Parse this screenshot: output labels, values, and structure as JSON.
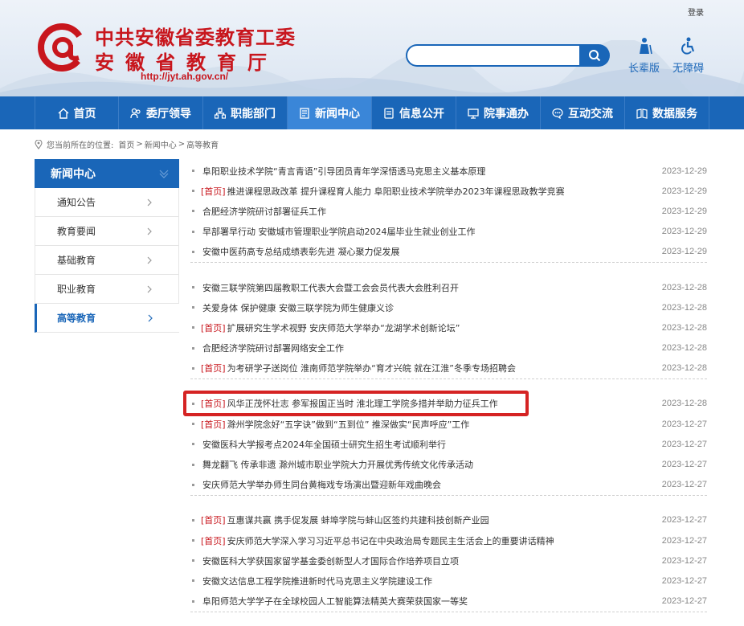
{
  "header": {
    "login": "登录",
    "title_line1": "中共安徽省委教育工委",
    "title_line2": "安徽省教育厅",
    "url": "http://jyt.ah.gov.cn/",
    "tools": [
      {
        "label": "长辈版",
        "icon": "elder-icon"
      },
      {
        "label": "无障碍",
        "icon": "accessibility-icon"
      }
    ],
    "search": {
      "placeholder": ""
    }
  },
  "nav": {
    "items": [
      {
        "label": "首页",
        "icon": "home-icon"
      },
      {
        "label": "委厅领导",
        "icon": "leaders-icon"
      },
      {
        "label": "职能部门",
        "icon": "departments-icon"
      },
      {
        "label": "新闻中心",
        "icon": "news-icon",
        "active": true
      },
      {
        "label": "信息公开",
        "icon": "info-icon"
      },
      {
        "label": "院事通办",
        "icon": "service-icon"
      },
      {
        "label": "互动交流",
        "icon": "chat-icon"
      },
      {
        "label": "数据服务",
        "icon": "data-icon"
      }
    ]
  },
  "breadcrumb": {
    "prefix": "您当前所在的位置:",
    "crumbs": [
      "首页",
      "新闻中心",
      "高等教育"
    ],
    "separator": ">"
  },
  "sidebar": {
    "heading": "新闻中心",
    "items": [
      {
        "label": "通知公告"
      },
      {
        "label": "教育要闻"
      },
      {
        "label": "基础教育"
      },
      {
        "label": "职业教育"
      },
      {
        "label": "高等教育",
        "active": true
      }
    ]
  },
  "list": {
    "groups": [
      [
        {
          "tag": "",
          "title": "阜阳职业技术学院“青言青语”引导团员青年学深悟透马克思主义基本原理",
          "date": "2023-12-29"
        },
        {
          "tag": "[首页]",
          "title": "推进课程思政改革 提升课程育人能力 阜阳职业技术学院举办2023年课程思政教学竞赛",
          "date": "2023-12-29"
        },
        {
          "tag": "",
          "title": "合肥经济学院研讨部署征兵工作",
          "date": "2023-12-29"
        },
        {
          "tag": "",
          "title": "早部署早行动 安徽城市管理职业学院启动2024届毕业生就业创业工作",
          "date": "2023-12-29"
        },
        {
          "tag": "",
          "title": "安徽中医药高专总结成绩表彰先进 凝心聚力促发展",
          "date": "2023-12-29"
        }
      ],
      [
        {
          "tag": "",
          "title": "安徽三联学院第四届教职工代表大会暨工会会员代表大会胜利召开",
          "date": "2023-12-28"
        },
        {
          "tag": "",
          "title": "关爱身体 保护健康 安徽三联学院为师生健康义诊",
          "date": "2023-12-28"
        },
        {
          "tag": "[首页]",
          "title": "扩展研究生学术视野 安庆师范大学举办“龙湖学术创新论坛”",
          "date": "2023-12-28"
        },
        {
          "tag": "",
          "title": "合肥经济学院研讨部署网络安全工作",
          "date": "2023-12-28"
        },
        {
          "tag": "[首页]",
          "title": "为考研学子送岗位 淮南师范学院举办“育才兴皖 就在江淮”冬季专场招聘会",
          "date": "2023-12-28"
        }
      ],
      [
        {
          "tag": "[首页]",
          "title": "风华正茂怀壮志 参军报国正当时 淮北理工学院多措并举助力征兵工作",
          "date": "2023-12-28"
        },
        {
          "tag": "[首页]",
          "title": "滁州学院念好“五字诀”做到“五到位” 推深做实“民声呼应”工作",
          "date": "2023-12-27"
        },
        {
          "tag": "",
          "title": "安徽医科大学报考点2024年全国硕士研究生招生考试顺利举行",
          "date": "2023-12-27"
        },
        {
          "tag": "",
          "title": "舞龙翻飞 传承非遗 滁州城市职业学院大力开展优秀传统文化传承活动",
          "date": "2023-12-27"
        },
        {
          "tag": "",
          "title": "安庆师范大学举办师生同台黄梅戏专场演出暨迎新年戏曲晚会",
          "date": "2023-12-27"
        }
      ],
      [
        {
          "tag": "[首页]",
          "title": "互惠谋共赢 携手促发展 蚌埠学院与蚌山区签约共建科技创新产业园",
          "date": "2023-12-27"
        },
        {
          "tag": "[首页]",
          "title": "安庆师范大学深入学习习近平总书记在中央政治局专题民主生活会上的重要讲话精神",
          "date": "2023-12-27"
        },
        {
          "tag": "",
          "title": "安徽医科大学获国家留学基金委创新型人才国际合作培养项目立项",
          "date": "2023-12-27"
        },
        {
          "tag": "",
          "title": "安徽文达信息工程学院推进新时代马克思主义学院建设工作",
          "date": "2023-12-27"
        },
        {
          "tag": "",
          "title": "阜阳师范大学学子在全球校园人工智能算法精英大赛荣获国家一等奖",
          "date": "2023-12-27"
        }
      ]
    ]
  },
  "colors": {
    "primary": "#1a66b8",
    "accent": "#c8161d",
    "highlight": "#d52323"
  }
}
